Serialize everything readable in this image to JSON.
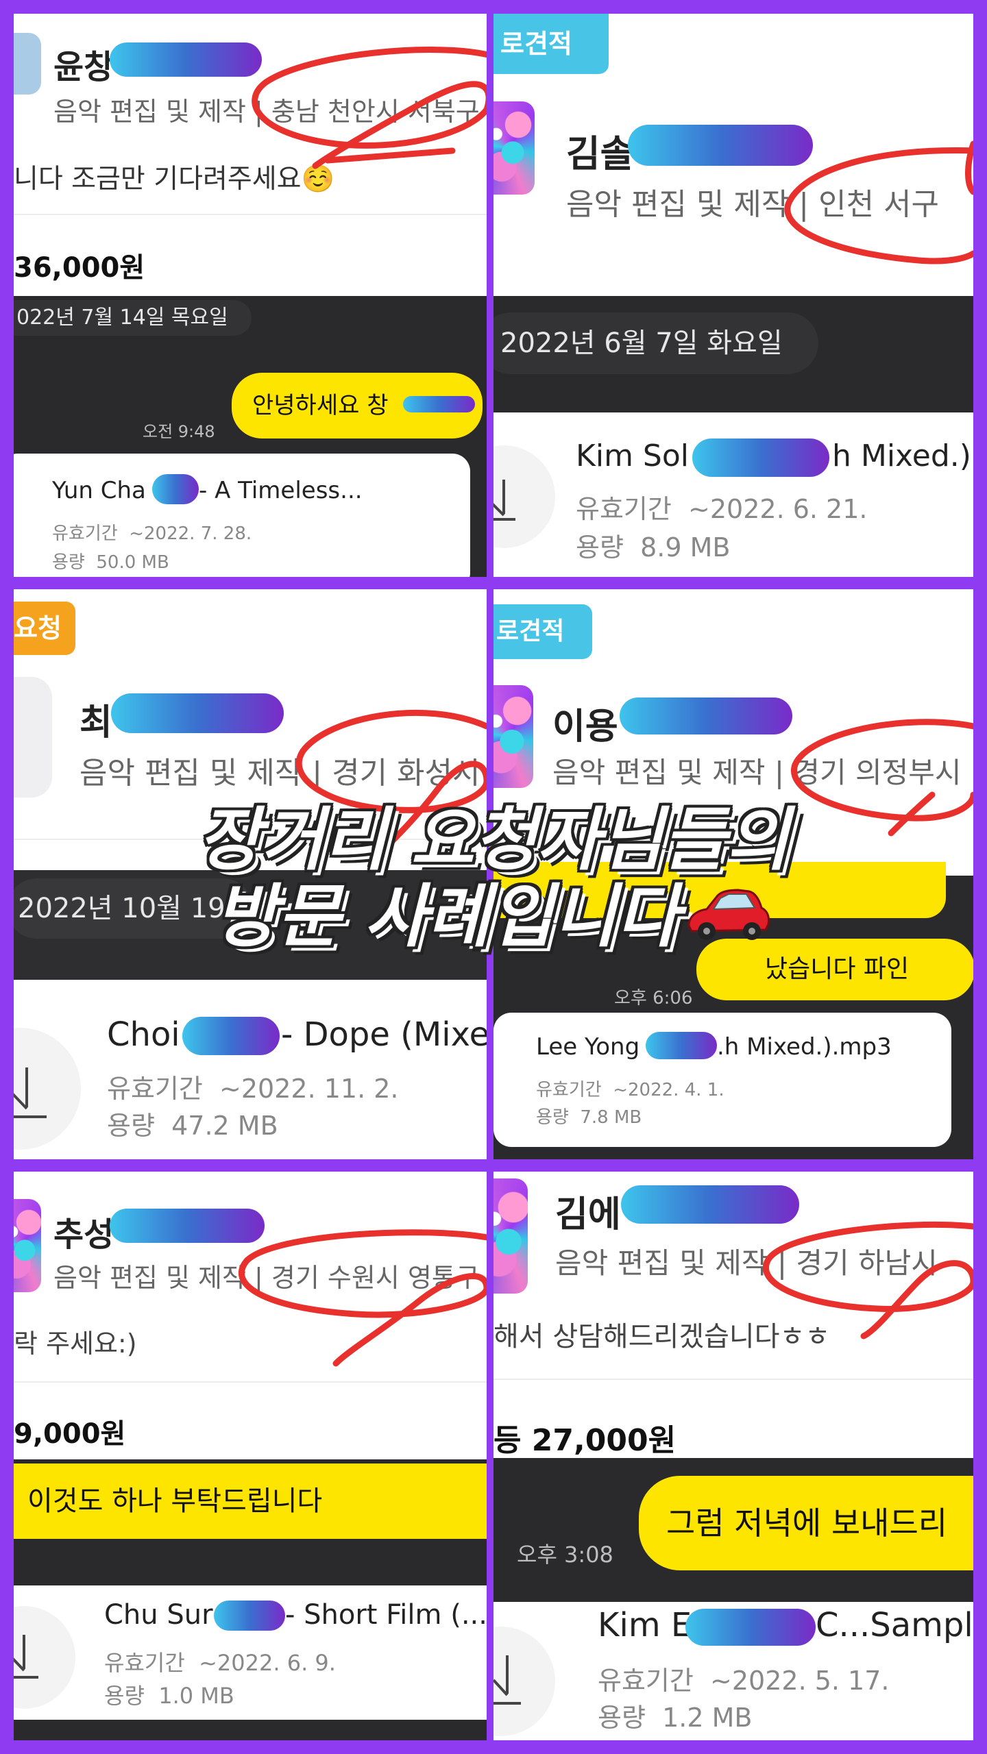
{
  "overlay": {
    "line1": "장거리 요청자님들의",
    "line2": "방문 사례입니다"
  },
  "panels": [
    {
      "name": "윤창",
      "subtitle": "음악 편집 및 제작 | 충남 천안시 서북구",
      "message": "니다 조금만 기다려주세요☺️",
      "price": "36,000원",
      "date": "022년 7월 14일 목요일",
      "bubble": "안녕하세요 창",
      "time": "오전 9:48",
      "file": {
        "title_pre": "Yun Cha",
        "title_post": "- A Timeless...",
        "expiry_label": "유효기간",
        "expiry": "~2022. 7. 28.",
        "size_label": "용량",
        "size": "50.0 MB"
      }
    },
    {
      "tag": "로견적",
      "name": "김솔",
      "subtitle": "음악 편집 및 제작 | 인천 서구",
      "date": "2022년 6월 7일 화요일",
      "file": {
        "title_pre": "Kim Sol",
        "title_post": "h Mixed.)",
        "expiry_label": "유효기간",
        "expiry": "~2022. 6. 21.",
        "size_label": "용량",
        "size": "8.9 MB"
      }
    },
    {
      "tag": "요청",
      "name": "최",
      "subtitle": "음악 편집 및 제작 | 경기 화성시",
      "date": "2022년 10월 19",
      "file": {
        "title_pre": "Choi",
        "title_post": "- Dope (Mixe",
        "expiry_label": "유효기간",
        "expiry": "~2022. 11. 2.",
        "size_label": "용량",
        "size": "47.2 MB"
      }
    },
    {
      "tag": "로견적",
      "name": "이용",
      "subtitle": "음악 편집 및 제작 | 경기 의정부시",
      "bubble": "났습니다 파인",
      "time": "오후 6:06",
      "file": {
        "title_pre": "Lee Yong",
        "title_post": ".h Mixed.).mp3",
        "expiry_label": "유효기간",
        "expiry": "~2022. 4. 1.",
        "size_label": "용량",
        "size": "7.8 MB"
      }
    },
    {
      "name": "추성",
      "subtitle": "음악 편집 및 제작 | 경기 수원시 영통구",
      "message": "락 주세요:)",
      "price": "9,000원",
      "bubble": "이것도 하나 부탁드립니다",
      "file": {
        "title_pre": "Chu Sur",
        "title_post": " - Short Film (...",
        "expiry_label": "유효기간",
        "expiry": "~2022. 6. 9.",
        "size_label": "용량",
        "size": "1.0 MB"
      }
    },
    {
      "name": "김에",
      "subtitle": "음악 편집 및 제작 | 경기 하남시",
      "message": "해서 상담해드리겠습니다ㅎㅎ",
      "price": "등 27,000원",
      "bubble": "그럼 저녁에 보내드리",
      "time": "오후 3:08",
      "file": {
        "title_pre": "Kim E",
        "title_post": "C...Sample",
        "expiry_label": "유효기간",
        "expiry": "~2022. 5. 17.",
        "size_label": "용량",
        "size": "1.2 MB"
      }
    }
  ],
  "colors": {
    "border": "#8f3bf2",
    "kakao_yellow": "#fee500",
    "annotation_red": "#e8302c",
    "tag_blue": "#48c4e6",
    "tag_orange": "#f5a21e",
    "chat_dark": "#2a2a2c"
  },
  "icons": {
    "download": "download-icon",
    "car": "red-car-emoji"
  }
}
